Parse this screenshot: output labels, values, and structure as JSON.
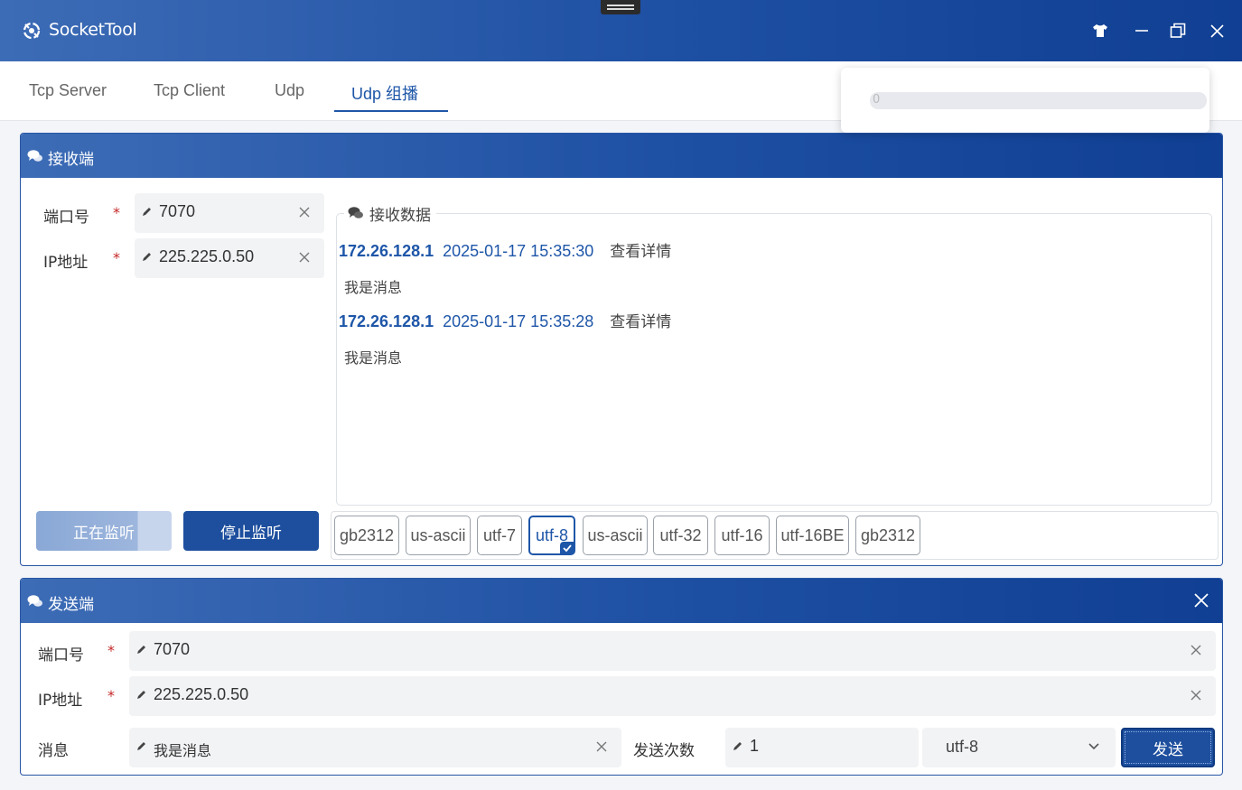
{
  "app": {
    "title": "SocketTool"
  },
  "tabs": [
    {
      "label": "Tcp Server",
      "active": false
    },
    {
      "label": "Tcp Client",
      "active": false
    },
    {
      "label": "Udp",
      "active": false
    },
    {
      "label": "Udp 组播",
      "active": true
    }
  ],
  "popup": {
    "progress_text": "0",
    "progress": 0
  },
  "receiver": {
    "title": "接收端",
    "port_label": "端口号",
    "port_value": "7070",
    "ip_label": "IP地址",
    "ip_value": "225.225.0.50",
    "recv_title": "接收数据",
    "messages": [
      {
        "ip": "172.26.128.1",
        "time": "2025-01-17 15:35:30",
        "link": "查看详情",
        "body": "我是消息"
      },
      {
        "ip": "172.26.128.1",
        "time": "2025-01-17 15:35:28",
        "link": "查看详情",
        "body": "我是消息"
      }
    ],
    "listen_button": "正在监听",
    "stop_button": "停止监听",
    "encodings": [
      "gb2312",
      "us-ascii",
      "utf-7",
      "utf-8",
      "us-ascii",
      "utf-32",
      "utf-16",
      "utf-16BE",
      "gb2312"
    ],
    "selected_encoding": "utf-8"
  },
  "sender": {
    "title": "发送端",
    "port_label": "端口号",
    "port_value": "7070",
    "ip_label": "IP地址",
    "ip_value": "225.225.0.50",
    "message_label": "消息",
    "message_value": "我是消息",
    "count_label": "发送次数",
    "count_value": "1",
    "encoding_value": "utf-8",
    "send_button": "发送"
  },
  "required_mark": "*",
  "colors": {
    "primary": "#1e56a8",
    "header_start": "#3d6cb6",
    "header_end": "#103f93",
    "required": "#c62828"
  }
}
